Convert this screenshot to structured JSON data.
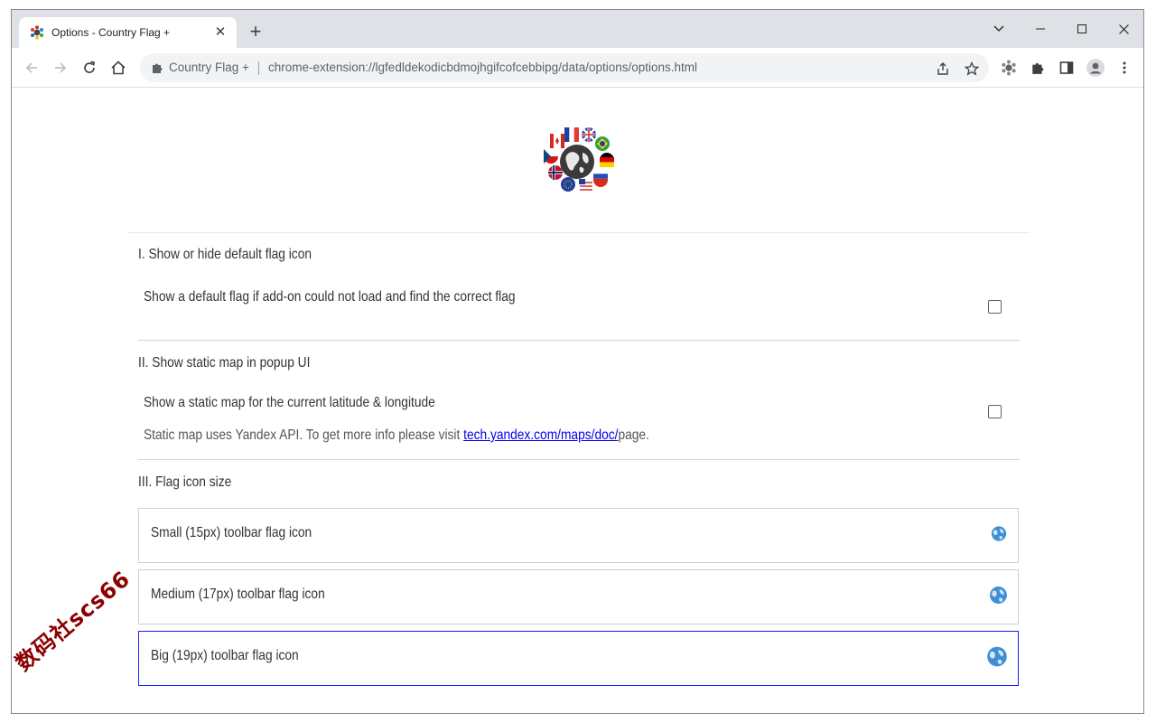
{
  "browser": {
    "tab": {
      "title": "Options - Country Flag +",
      "close_glyph": "✕"
    },
    "new_tab_glyph": "+",
    "window_controls": {
      "collapse": "chevron-down-icon",
      "minimize": "minimize-icon",
      "maximize": "maximize-icon",
      "close": "close-icon"
    },
    "omnibox": {
      "extension_name": "Country Flag +",
      "url": "chrome-extension://lgfedldekodicbdmojhgifcofcebbipg/data/options/options.html"
    }
  },
  "page": {
    "sections": [
      {
        "title": "I. Show or hide default flag icon",
        "option_label": "Show a default flag if add-on could not load and find the correct flag",
        "checked": false
      },
      {
        "title": "II. Show static map in popup UI",
        "option_label": "Show a static map for the current latitude & longitude",
        "note_prefix": "Static map uses Yandex API. To get more info please visit ",
        "note_link": "tech.yandex.com/maps/doc/",
        "note_suffix": "page.",
        "checked": false
      },
      {
        "title": "III. Flag icon size",
        "sizes": [
          {
            "label": "Small (15px) toolbar flag icon",
            "selected": false
          },
          {
            "label": "Medium (17px) toolbar flag icon",
            "selected": false
          },
          {
            "label": "Big (19px) toolbar flag icon",
            "selected": true
          }
        ]
      }
    ]
  },
  "watermark": "数码社scs66",
  "colors": {
    "selected_border": "#1c1cff",
    "link": "#0000ee",
    "watermark": "#8b0000"
  }
}
